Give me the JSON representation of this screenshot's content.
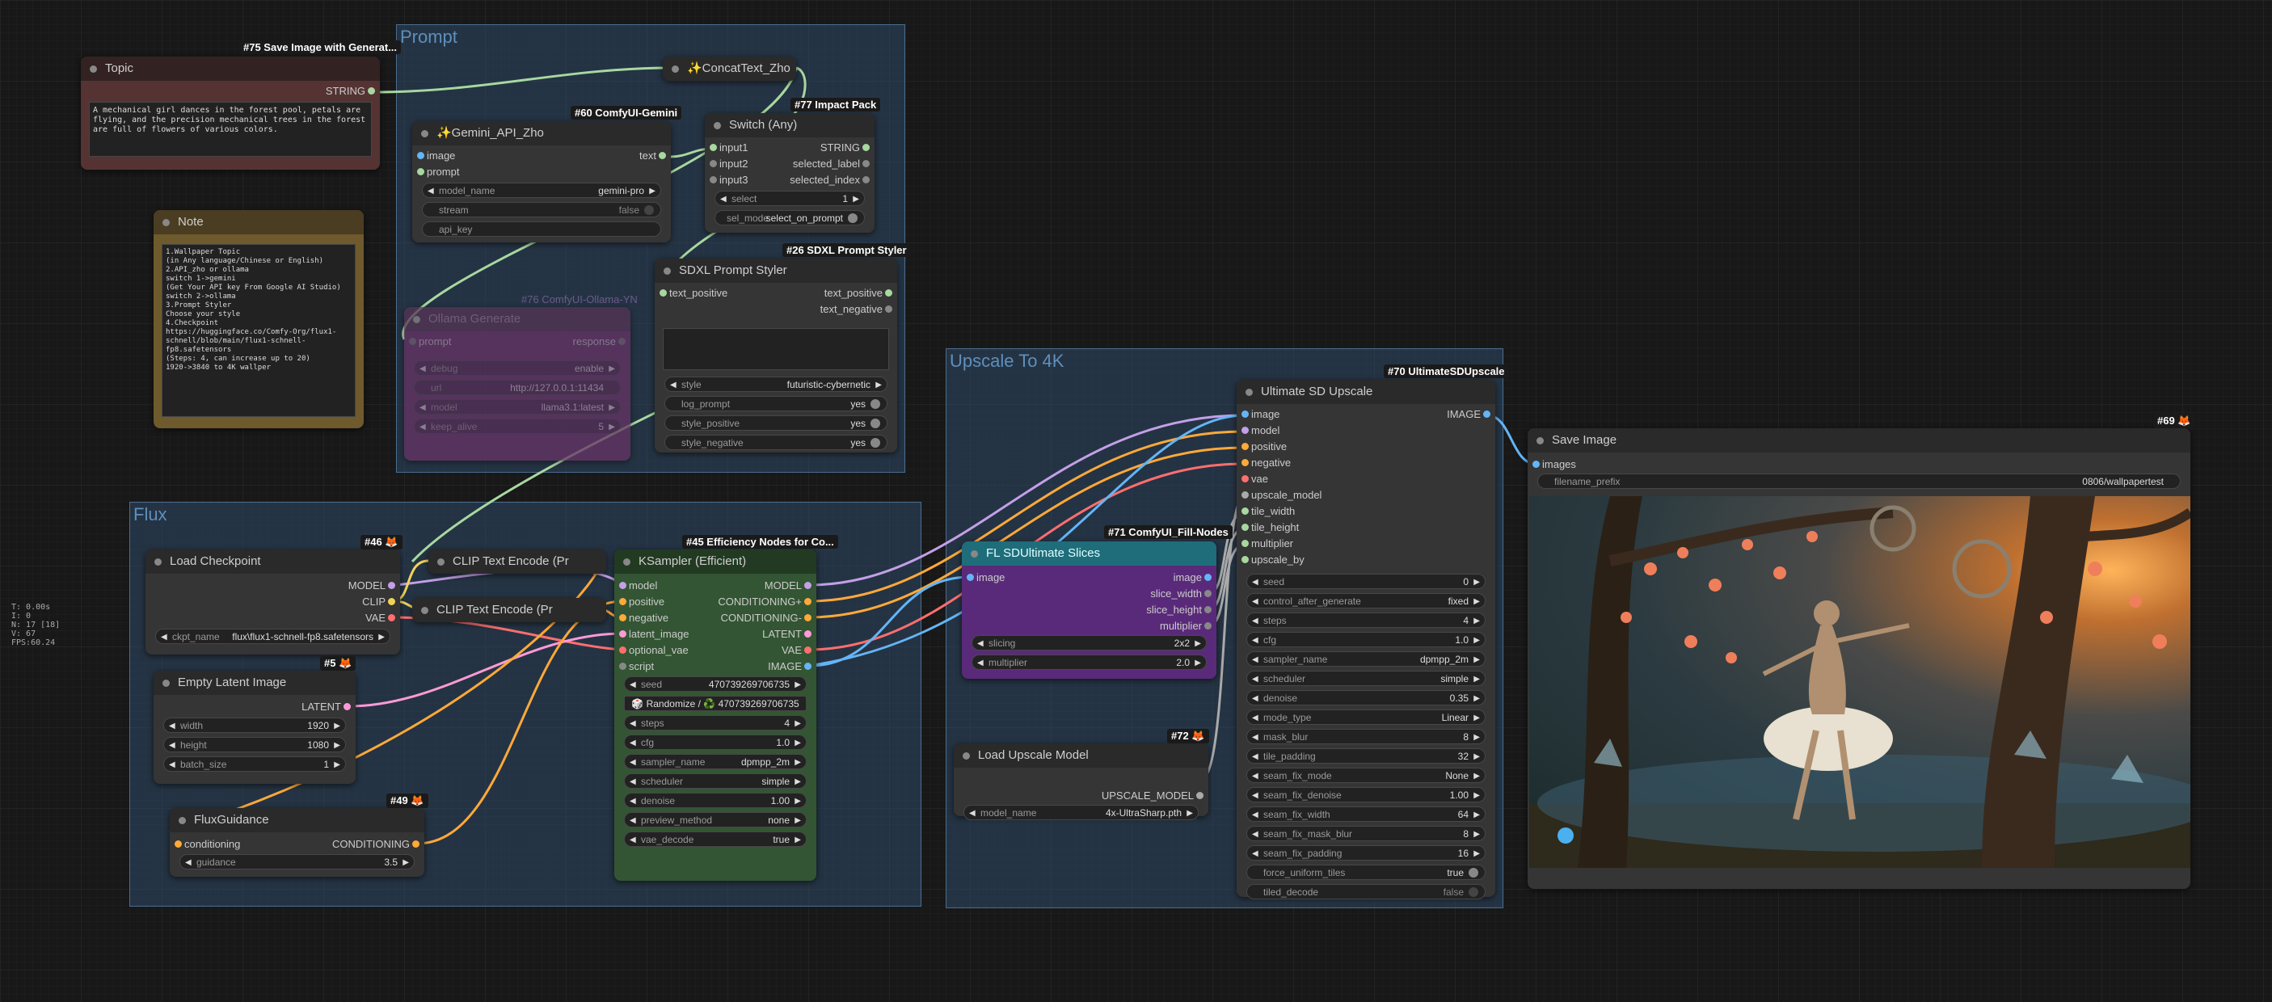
{
  "groups": {
    "prompt": "Prompt",
    "flux": "Flux",
    "upscale": "Upscale To 4K"
  },
  "stats": "T: 0.00s\nI: 0\nN: 17 [18]\nV: 67\nFPS:60.24",
  "badges": {
    "save_image_generate": "#75 Save Image with Generat...",
    "comfyui_gemini": "#60 ComfyUI-Gemini",
    "impact_pack": "#77 Impact Pack",
    "sdxl_prompt_styler": "#26 SDXL Prompt Styler",
    "ollama_yn": "#76 ComfyUI-Ollama-YN",
    "ultimate_sd": "#70 UltimateSDUpscale",
    "node_69": "#69 🦊",
    "node_46": "#46 🦊",
    "efficiency": "#45 Efficiency Nodes for Co...",
    "fill_nodes": "#71 ComfyUI_Fill-Nodes",
    "node_5": "#5 🦊",
    "node_72": "#72 🦊",
    "node_49": "#49 🦊"
  },
  "topic": {
    "title": "Topic",
    "out": "STRING",
    "text": "A mechanical girl dances in the forest pool, petals are flying, and the precision mechanical trees in the forest are full of flowers of various colors."
  },
  "note": {
    "title": "Note",
    "text": "1.Wallpaper Topic\n(in Any language/Chinese or English)\n2.API_zho or ollama\nswitch 1->gemini\n(Get Your API key From Google AI Studio)\nswitch 2->ollama\n3.Prompt Styler\nChoose your style\n4.Checkpoint\nhttps://huggingface.co/Comfy-Org/flux1-schnell/blob/main/flux1-schnell-fp8.safetensors\n(Steps: 4, can increase up to 20)\n1920->3840 to 4K wallper"
  },
  "concat": {
    "title": "✨ConcatText_Zho"
  },
  "gemini": {
    "title": "✨Gemini_API_Zho",
    "in_image": "image",
    "in_prompt": "prompt",
    "out_text": "text",
    "model_label": "model_name",
    "model_value": "gemini-pro",
    "stream_label": "stream",
    "stream_value": "false",
    "api_key_label": "api_key"
  },
  "switch": {
    "title": "Switch (Any)",
    "in1": "input1",
    "in2": "input2",
    "in3": "input3",
    "out_string": "STRING",
    "out_label": "selected_label",
    "out_index": "selected_index",
    "select_label": "select",
    "select_value": "1",
    "selmode_label": "sel_mode",
    "selmode_value": "select_on_prompt"
  },
  "styler": {
    "title": "SDXL Prompt Styler",
    "in_pos": "text_positive",
    "out_pos": "text_positive",
    "out_neg": "text_negative",
    "style_label": "style",
    "style_value": "futuristic-cybernetic",
    "log_label": "log_prompt",
    "log_value": "yes",
    "sp_label": "style_positive",
    "sp_value": "yes",
    "sn_label": "style_negative",
    "sn_value": "yes"
  },
  "ollama": {
    "title": "Ollama Generate",
    "in_prompt": "prompt",
    "out_response": "response",
    "debug_label": "debug",
    "debug_value": "enable",
    "url_label": "url",
    "url_value": "http://127.0.0.1:11434",
    "model_label": "model",
    "model_value": "llama3.1:latest",
    "keep_label": "keep_alive",
    "keep_value": "5"
  },
  "checkpoint": {
    "title": "Load Checkpoint",
    "out_model": "MODEL",
    "out_clip": "CLIP",
    "out_vae": "VAE",
    "ckpt_label": "ckpt_name",
    "ckpt_value": "flux\\flux1-schnell-fp8.safetensors"
  },
  "clip1": {
    "title": "CLIP Text Encode (Pr"
  },
  "clip2": {
    "title": "CLIP Text Encode (Pr"
  },
  "latent": {
    "title": "Empty Latent Image",
    "out": "LATENT",
    "width_label": "width",
    "width_value": "1920",
    "height_label": "height",
    "height_value": "1080",
    "batch_label": "batch_size",
    "batch_value": "1"
  },
  "guidance": {
    "title": "FluxGuidance",
    "in": "conditioning",
    "out": "CONDITIONING",
    "g_label": "guidance",
    "g_value": "3.5"
  },
  "ksampler": {
    "title": "KSampler (Efficient)",
    "in_model": "model",
    "in_pos": "positive",
    "in_neg": "negative",
    "in_latent": "latent_image",
    "in_vae": "optional_vae",
    "in_script": "script",
    "out_model": "MODEL",
    "out_pos": "CONDITIONING+",
    "out_neg": "CONDITIONING-",
    "out_latent": "LATENT",
    "out_vae": "VAE",
    "out_image": "IMAGE",
    "seed_label": "seed",
    "seed_value": "470739269706735",
    "randomize": "🎲 Randomize / ♻️ 470739269706735",
    "steps_label": "steps",
    "steps_value": "4",
    "cfg_label": "cfg",
    "cfg_value": "1.0",
    "sampler_label": "sampler_name",
    "sampler_value": "dpmpp_2m",
    "scheduler_label": "scheduler",
    "scheduler_value": "simple",
    "denoise_label": "denoise",
    "denoise_value": "1.00",
    "preview_label": "preview_method",
    "preview_value": "none",
    "vaedec_label": "vae_decode",
    "vaedec_value": "true"
  },
  "slices": {
    "title": "FL SDUltimate Slices",
    "in_image": "image",
    "out_image": "image",
    "out_sw": "slice_width",
    "out_sh": "slice_height",
    "out_mult": "multiplier",
    "slicing_label": "slicing",
    "slicing_value": "2x2",
    "mult_label": "multiplier",
    "mult_value": "2.0"
  },
  "upscale_model": {
    "title": "Load Upscale Model",
    "out": "UPSCALE_MODEL",
    "model_label": "model_name",
    "model_value": "4x-UltraSharp.pth"
  },
  "usd": {
    "title": "Ultimate SD Upscale",
    "out": "IMAGE",
    "inputs": [
      "image",
      "model",
      "positive",
      "negative",
      "vae",
      "upscale_model",
      "tile_width",
      "tile_height",
      "multiplier",
      "upscale_by"
    ],
    "widgets": [
      {
        "label": "seed",
        "value": "0"
      },
      {
        "label": "control_after_generate",
        "value": "fixed"
      },
      {
        "label": "steps",
        "value": "4"
      },
      {
        "label": "cfg",
        "value": "1.0"
      },
      {
        "label": "sampler_name",
        "value": "dpmpp_2m"
      },
      {
        "label": "scheduler",
        "value": "simple"
      },
      {
        "label": "denoise",
        "value": "0.35"
      },
      {
        "label": "mode_type",
        "value": "Linear"
      },
      {
        "label": "mask_blur",
        "value": "8"
      },
      {
        "label": "tile_padding",
        "value": "32"
      },
      {
        "label": "seam_fix_mode",
        "value": "None"
      },
      {
        "label": "seam_fix_denoise",
        "value": "1.00"
      },
      {
        "label": "seam_fix_width",
        "value": "64"
      },
      {
        "label": "seam_fix_mask_blur",
        "value": "8"
      },
      {
        "label": "seam_fix_padding",
        "value": "16"
      }
    ],
    "fu_label": "force_uniform_tiles",
    "fu_value": "true",
    "td_label": "tiled_decode",
    "td_value": "false"
  },
  "save": {
    "title": "Save Image",
    "in": "images",
    "prefix_label": "filename_prefix",
    "prefix_value": "0806/wallpapertest"
  }
}
